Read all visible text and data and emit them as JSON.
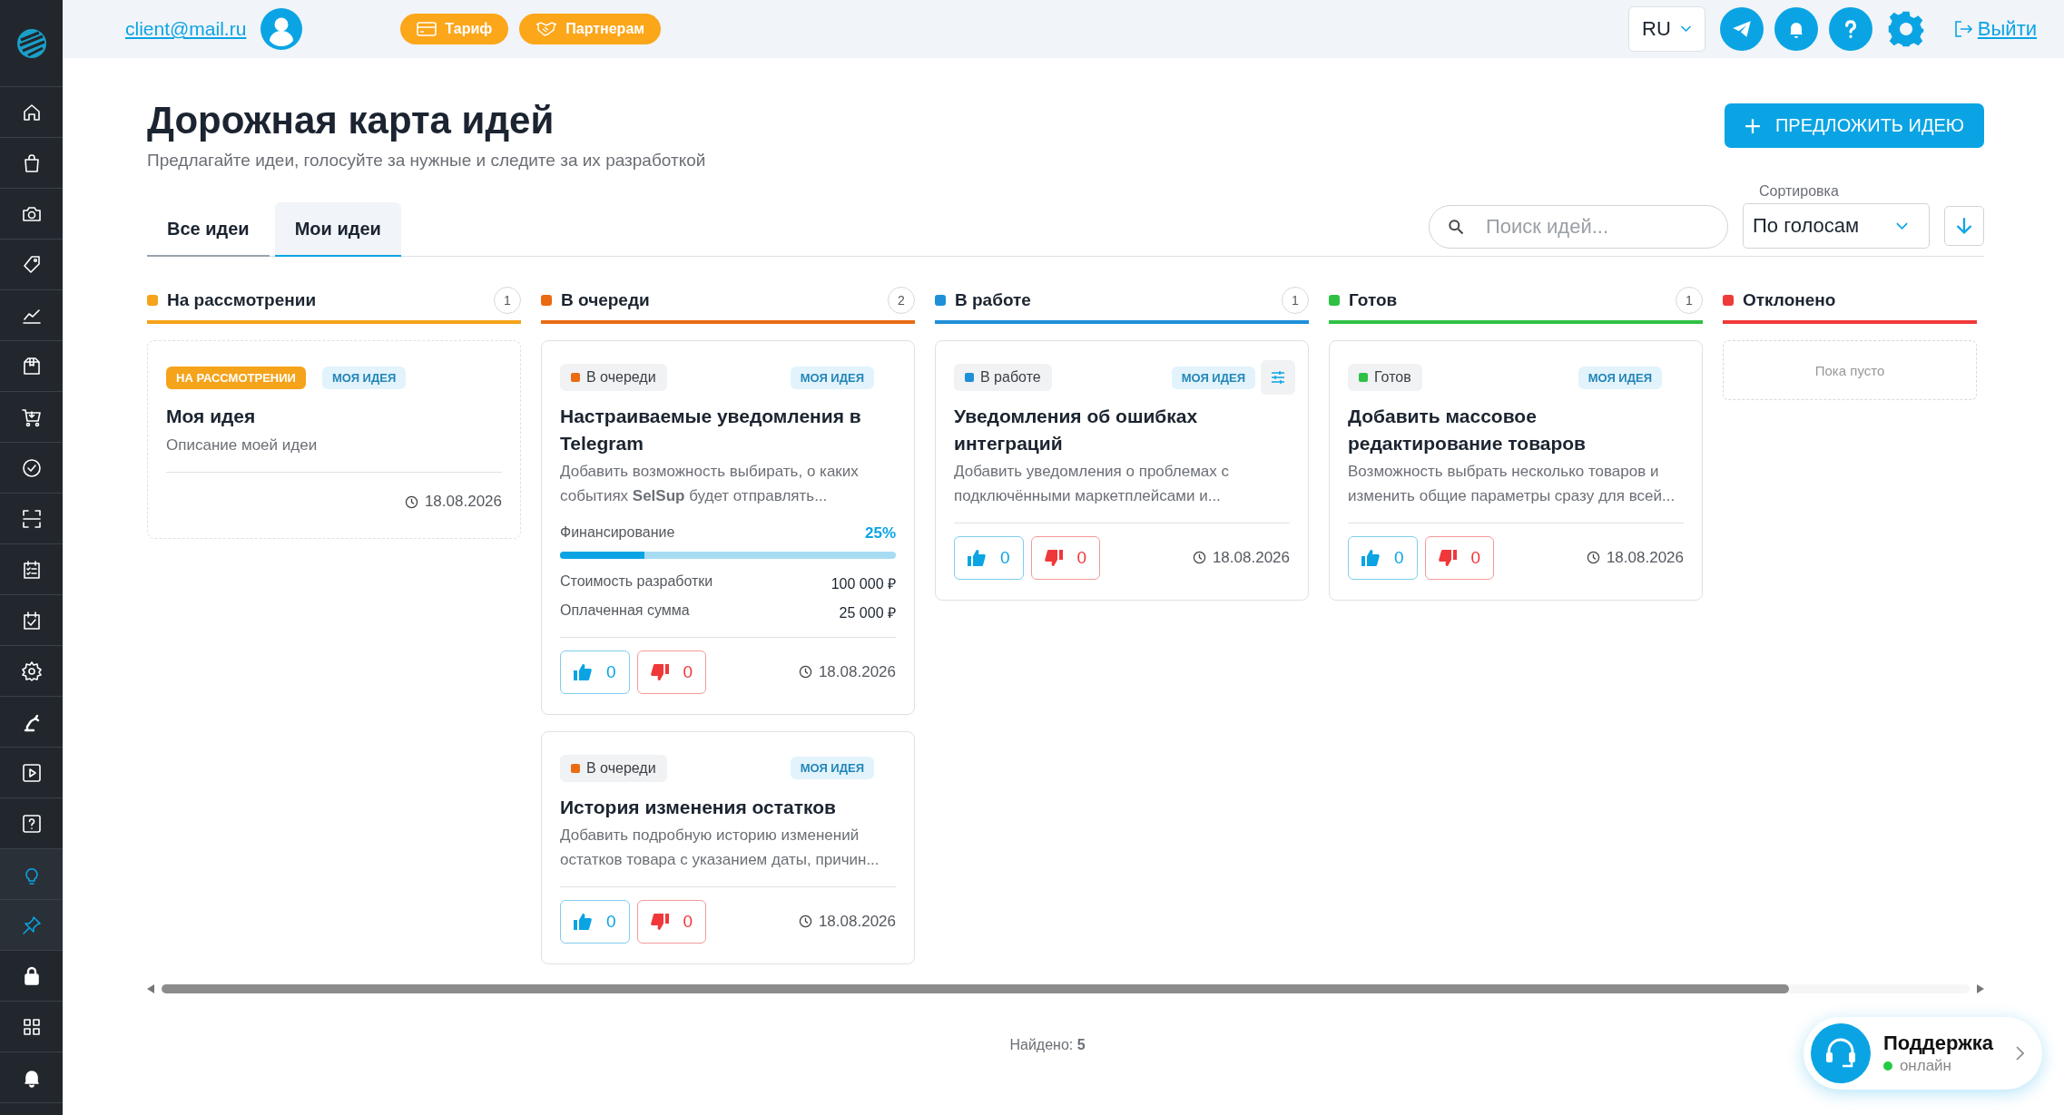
{
  "topbar": {
    "email": "client@mail.ru",
    "pills": [
      {
        "label": "Тариф",
        "kind": "card"
      },
      {
        "label": "Партнерам",
        "kind": "handshake"
      }
    ],
    "language": "RU",
    "logout": "Выйти"
  },
  "sidebar": {
    "items": [
      {
        "kind": "home",
        "selected": false
      },
      {
        "kind": "bag",
        "selected": false
      },
      {
        "kind": "camera",
        "selected": false
      },
      {
        "kind": "tag",
        "selected": false
      },
      {
        "kind": "chart",
        "selected": false
      },
      {
        "kind": "box",
        "selected": false
      },
      {
        "kind": "cart",
        "selected": false
      },
      {
        "kind": "check",
        "selected": false
      },
      {
        "kind": "scan",
        "selected": false
      },
      {
        "kind": "list",
        "selected": false
      },
      {
        "kind": "calendar",
        "selected": false
      },
      {
        "kind": "gear",
        "selected": false
      },
      {
        "kind": "robot",
        "selected": false
      },
      {
        "kind": "play",
        "selected": false
      },
      {
        "kind": "question",
        "selected": false
      },
      {
        "kind": "bulb",
        "selected": true
      },
      {
        "kind": "pin",
        "selected": true
      },
      {
        "kind": "lock",
        "selected": false
      },
      {
        "kind": "grid",
        "selected": false
      },
      {
        "kind": "bell",
        "selected": false
      }
    ]
  },
  "header": {
    "title": "Дорожная карта идей",
    "subtitle": "Предлагайте идеи, голосуйте за нужные и следите за их разработкой",
    "action": "ПРЕДЛОЖИТЬ ИДЕЮ"
  },
  "tabs": [
    {
      "label": "Все идеи",
      "selected": false
    },
    {
      "label": "Мои идеи",
      "selected": true
    }
  ],
  "search": {
    "placeholder": "Поиск идей..."
  },
  "sort": {
    "label": "Сортировка",
    "value": "По голосам"
  },
  "columns": [
    {
      "name": "На рассмотрении",
      "color": "#f5a31a",
      "count": "1",
      "cards": [
        {
          "status": {
            "label": "НА РАССМОТРЕНИИ",
            "kind": "filled",
            "color": "#f5a31a"
          },
          "mine": "МОЯ ИДЕЯ",
          "title": "Моя идея",
          "description": "Описание моей идеи",
          "date": "18.08.2026",
          "dashed": true
        }
      ]
    },
    {
      "name": "В очереди",
      "color": "#ea6b12",
      "count": "2",
      "cards": [
        {
          "status": {
            "label": "В очереди",
            "kind": "chip",
            "color": "#ea6b12"
          },
          "mine": "МОЯ ИДЕЯ",
          "title": "Настраиваемые уведомления в Telegram",
          "description": "Добавить возможность выбирать, о каких событиях **SelSup** будет отправлять...",
          "funding": {
            "label": "Финансирование",
            "percent": "25%",
            "level": 0.25,
            "rows": [
              {
                "label": "Стоимость разработки",
                "value": "100 000 ₽"
              },
              {
                "label": "Оплаченная сумма",
                "value": "25 000 ₽"
              }
            ]
          },
          "votes": {
            "up": "0",
            "down": "0"
          },
          "date": "18.08.2026",
          "dashed": false
        },
        {
          "status": {
            "label": "В очереди",
            "kind": "chip",
            "color": "#ea6b12"
          },
          "mine": "МОЯ ИДЕЯ",
          "title": "История изменения остатков",
          "description": "Добавить подробную историю изменений остатков товара с указанием даты, причин...",
          "votes": {
            "up": "0",
            "down": "0"
          },
          "date": "18.08.2026",
          "dashed": false
        }
      ]
    },
    {
      "name": "В работе",
      "color": "#1e8fd8",
      "count": "1",
      "cards": [
        {
          "status": {
            "label": "В работе",
            "kind": "chip",
            "color": "#1e8fd8"
          },
          "mine": "МОЯ ИДЕЯ",
          "settings": true,
          "title": "Уведомления об ошибках интеграций",
          "description": "Добавить уведомления о проблемах с подключёнными маркетплейсами и...",
          "votes": {
            "up": "0",
            "down": "0"
          },
          "date": "18.08.2026",
          "dashed": false
        }
      ]
    },
    {
      "name": "Готов",
      "color": "#2fc144",
      "count": "1",
      "cards": [
        {
          "status": {
            "label": "Готов",
            "kind": "chip",
            "color": "#2fc144"
          },
          "mine": "МОЯ ИДЕЯ",
          "title": "Добавить массовое редактирование товаров",
          "description": "Возможность выбрать несколько товаров и изменить общие параметры сразу для всей...",
          "votes": {
            "up": "0",
            "down": "0"
          },
          "date": "18.08.2026",
          "dashed": false
        }
      ]
    },
    {
      "name": "Отклонено",
      "color": "#f03a3a",
      "empty": "Пока пусто"
    }
  ],
  "found": "Найдено: **5**",
  "support": {
    "title": "Поддержка",
    "status": "онлайн"
  }
}
